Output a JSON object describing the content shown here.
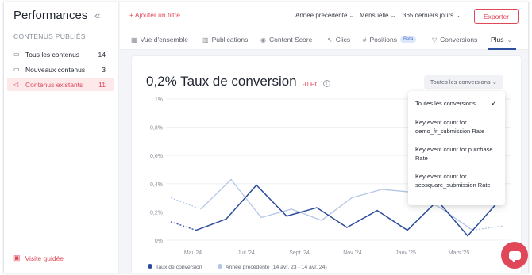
{
  "sidebar": {
    "title": "Performances",
    "collapse_icon": "«",
    "section_label": "CONTENUS PUBLIÉS",
    "items": [
      {
        "label": "Tous les contenus",
        "count": "14",
        "icon": "document-icon"
      },
      {
        "label": "Nouveaux contenus",
        "count": "3",
        "icon": "document-icon"
      },
      {
        "label": "Contenus existants",
        "count": "11",
        "icon": "megaphone-icon"
      }
    ],
    "guided_visit": "Visite guidée"
  },
  "topbar": {
    "add_filter": "+ Ajouter un filtre",
    "compare": "Année précédente",
    "granularity": "Mensuelle",
    "period": "365 derniers jours",
    "export": "Exporter"
  },
  "tabs": [
    {
      "label": "Vue d'ensemble",
      "icon": "grid-icon"
    },
    {
      "label": "Publications",
      "icon": "bar-chart-icon"
    },
    {
      "label": "Content Score",
      "icon": "eye-icon"
    },
    {
      "label": "Clics",
      "icon": "cursor-icon"
    },
    {
      "label": "Positions",
      "icon": "hash-icon",
      "badge": "Beta"
    },
    {
      "label": "Conversions",
      "icon": "filter-icon"
    },
    {
      "label": "Plus",
      "icon": "chevron-down-icon"
    }
  ],
  "metric": {
    "title": "0,2% Taux de conversion",
    "delta": "-0 Pt",
    "selector": "Toutes les conversions"
  },
  "menu": {
    "items": [
      "Toutes les conversions",
      "Key event count for demo_fr_submission Rate",
      "Key event count for purchase Rate",
      "Key event count for seosquare_submission Rate"
    ],
    "check": "✓"
  },
  "chart_data": {
    "type": "line",
    "y_ticks": [
      "1%",
      "0,8%",
      "0,6%",
      "0,4%",
      "0,2%",
      "0%"
    ],
    "x_ticks": [
      "Mai '24",
      "Juil '24",
      "Sept '24",
      "Nov '24",
      "Janv '25",
      "Mars '25"
    ],
    "ylim": [
      0,
      1
    ],
    "series": [
      {
        "name": "Taux de conversion",
        "color": "#2b4c9b",
        "values": [
          0.07,
          0.15,
          0.39,
          0.17,
          0.23,
          0.09,
          0.21,
          0.07,
          0.28,
          0.03,
          0.27
        ]
      },
      {
        "name": "Année précédente (14 avr. 23 - 14 avr. 24)",
        "color": "#b4c6e6",
        "values": [
          0.3,
          0.22,
          0.43,
          0.16,
          0.22,
          0.14,
          0.3,
          0.36,
          0.34,
          0.22,
          0.07,
          0.1
        ]
      }
    ]
  }
}
